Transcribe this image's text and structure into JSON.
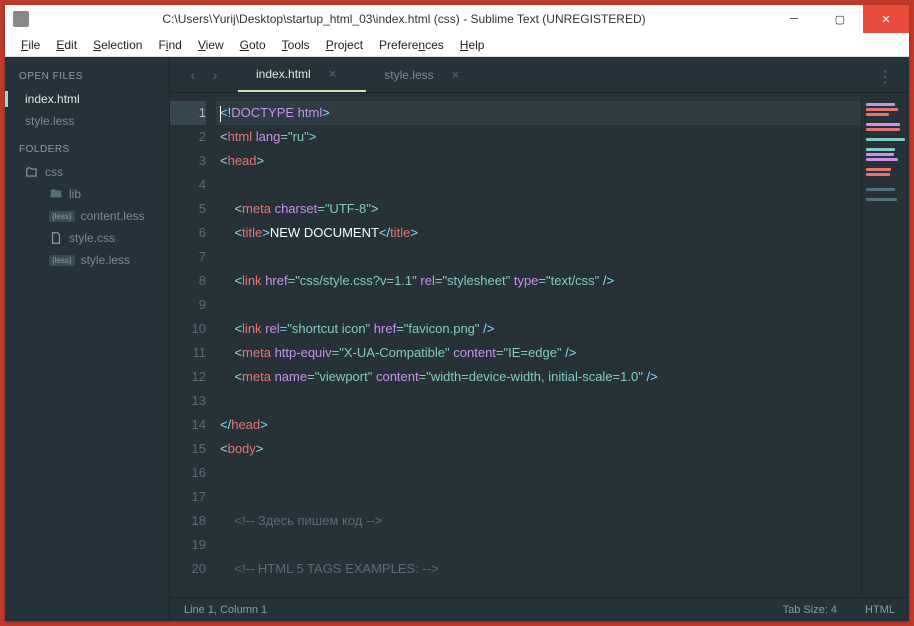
{
  "window": {
    "title": "C:\\Users\\Yurij\\Desktop\\startup_html_03\\index.html (css) - Sublime Text (UNREGISTERED)"
  },
  "menu": [
    "File",
    "Edit",
    "Selection",
    "Find",
    "View",
    "Goto",
    "Tools",
    "Project",
    "Preferences",
    "Help"
  ],
  "sidebar": {
    "open_files_title": "OPEN FILES",
    "open_files": [
      {
        "label": "index.html",
        "active": true
      },
      {
        "label": "style.less",
        "active": false
      }
    ],
    "folders_title": "FOLDERS",
    "root": "css",
    "children": [
      {
        "label": "lib",
        "type": "folder"
      },
      {
        "label": "content.less",
        "type": "file",
        "badge": "{less}"
      },
      {
        "label": "style.css",
        "type": "file",
        "icon": "css"
      },
      {
        "label": "style.less",
        "type": "file",
        "badge": "{less}"
      }
    ]
  },
  "tabs": [
    {
      "label": "index.html",
      "active": true
    },
    {
      "label": "style.less",
      "active": false
    }
  ],
  "code": {
    "lines": 20,
    "content": [
      {
        "t": "doctype",
        "raw": "<!DOCTYPE html>"
      },
      {
        "t": "tag",
        "raw": "<html lang=\"ru\">"
      },
      {
        "t": "tag",
        "raw": "<head>"
      },
      {
        "t": "blank"
      },
      {
        "t": "tag",
        "raw": "    <meta charset=\"UTF-8\">"
      },
      {
        "t": "tag",
        "raw": "    <title>NEW DOCUMENT</title>"
      },
      {
        "t": "blank"
      },
      {
        "t": "tag",
        "raw": "    <link href=\"css/style.css?v=1.1\" rel=\"stylesheet\" type=\"text/css\" />"
      },
      {
        "t": "blank"
      },
      {
        "t": "tag",
        "raw": "    <link rel=\"shortcut icon\" href=\"favicon.png\" />"
      },
      {
        "t": "tag",
        "raw": "    <meta http-equiv=\"X-UA-Compatible\" content=\"IE=edge\" />"
      },
      {
        "t": "tag",
        "raw": "    <meta name=\"viewport\" content=\"width=device-width, initial-scale=1.0\" />"
      },
      {
        "t": "blank"
      },
      {
        "t": "tag",
        "raw": "</head>"
      },
      {
        "t": "tag",
        "raw": "<body>"
      },
      {
        "t": "blank"
      },
      {
        "t": "blank"
      },
      {
        "t": "comment",
        "raw": "    <!-- Здесь пишем код -->"
      },
      {
        "t": "blank"
      },
      {
        "t": "comment",
        "raw": "    <!-- HTML 5 TAGS EXAMPLES: -->"
      }
    ]
  },
  "status": {
    "left": "Line 1, Column 1",
    "tab_size": "Tab Size: 4",
    "syntax": "HTML"
  }
}
